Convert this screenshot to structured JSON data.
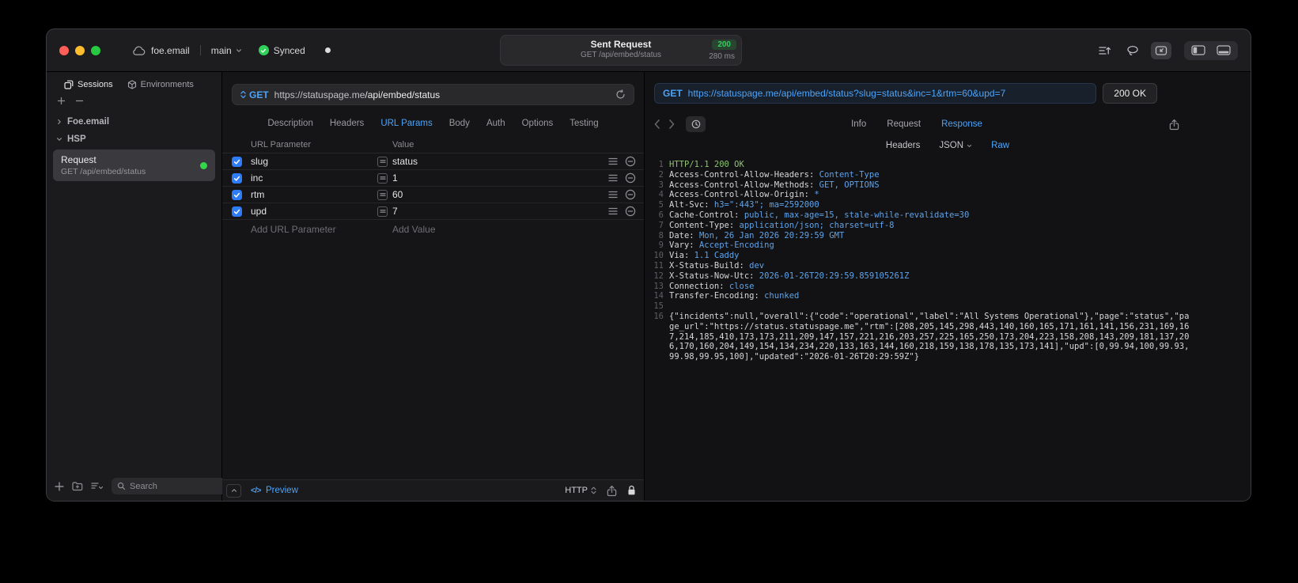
{
  "titlebar": {
    "project": "foe.email",
    "branch": "main",
    "sync_label": "Synced",
    "request_title": "Sent Request",
    "status_badge": "200",
    "request_subtitle": "GET /api/embed/status",
    "duration": "280 ms"
  },
  "sidebar": {
    "tabs": [
      {
        "label": "Sessions"
      },
      {
        "label": "Environments"
      }
    ],
    "tree": [
      {
        "label": "Foe.email"
      },
      {
        "label": "HSP"
      }
    ],
    "request_item": {
      "title": "Request",
      "subtitle": "GET /api/embed/status"
    },
    "search_placeholder": "Search"
  },
  "request": {
    "method": "GET",
    "url_domain": "https://statuspage.me",
    "url_path": "/api/embed/status",
    "tabs": [
      "Description",
      "Headers",
      "URL Params",
      "Body",
      "Auth",
      "Options",
      "Testing"
    ],
    "active_tab": "URL Params",
    "columns": {
      "name": "URL Parameter",
      "value": "Value"
    },
    "params": [
      {
        "name": "slug",
        "value": "status",
        "enabled": true
      },
      {
        "name": "inc",
        "value": "1",
        "enabled": true
      },
      {
        "name": "rtm",
        "value": "60",
        "enabled": true
      },
      {
        "name": "upd",
        "value": "7",
        "enabled": true
      }
    ],
    "add_name_placeholder": "Add URL Parameter",
    "add_value_placeholder": "Add Value",
    "footer": {
      "preview_icon": "</>",
      "preview_label": "Preview",
      "protocol": "HTTP"
    }
  },
  "response": {
    "method": "GET",
    "url": "https://statuspage.me/api/embed/status?slug=status&inc=1&rtm=60&upd=7",
    "status": "200 OK",
    "tabs": [
      "Info",
      "Request",
      "Response"
    ],
    "active_tab": "Response",
    "subtabs": [
      "Headers",
      "JSON",
      "Raw"
    ],
    "active_subtab": "Raw",
    "colors": {
      "accent_blue": "#4da3f8",
      "status_green": "#30d158"
    },
    "body_lines": [
      {
        "n": "1",
        "parts": [
          {
            "t": "HTTP/1.1 200 OK",
            "c": "green"
          }
        ]
      },
      {
        "n": "2",
        "parts": [
          {
            "t": "Access-Control-Allow-Headers: ",
            "c": "fg"
          },
          {
            "t": "Content-Type",
            "c": "blue"
          }
        ]
      },
      {
        "n": "3",
        "parts": [
          {
            "t": "Access-Control-Allow-Methods: ",
            "c": "fg"
          },
          {
            "t": "GET, OPTIONS",
            "c": "blue"
          }
        ]
      },
      {
        "n": "4",
        "parts": [
          {
            "t": "Access-Control-Allow-Origin: ",
            "c": "fg"
          },
          {
            "t": "*",
            "c": "blue"
          }
        ]
      },
      {
        "n": "5",
        "parts": [
          {
            "t": "Alt-Svc: ",
            "c": "fg"
          },
          {
            "t": "h3=\":443\"; ma=2592000",
            "c": "blue"
          }
        ]
      },
      {
        "n": "6",
        "parts": [
          {
            "t": "Cache-Control: ",
            "c": "fg"
          },
          {
            "t": "public, max-age=15, stale-while-revalidate=30",
            "c": "blue"
          }
        ]
      },
      {
        "n": "7",
        "parts": [
          {
            "t": "Content-Type: ",
            "c": "fg"
          },
          {
            "t": "application/json; charset=utf-8",
            "c": "blue"
          }
        ]
      },
      {
        "n": "8",
        "parts": [
          {
            "t": "Date: ",
            "c": "fg"
          },
          {
            "t": "Mon, 26 Jan 2026 20:29:59 GMT",
            "c": "blue"
          }
        ]
      },
      {
        "n": "9",
        "parts": [
          {
            "t": "Vary: ",
            "c": "fg"
          },
          {
            "t": "Accept-Encoding",
            "c": "blue"
          }
        ]
      },
      {
        "n": "10",
        "parts": [
          {
            "t": "Via: ",
            "c": "fg"
          },
          {
            "t": "1.1 Caddy",
            "c": "blue"
          }
        ]
      },
      {
        "n": "11",
        "parts": [
          {
            "t": "X-Status-Build: ",
            "c": "fg"
          },
          {
            "t": "dev",
            "c": "blue"
          }
        ]
      },
      {
        "n": "12",
        "parts": [
          {
            "t": "X-Status-Now-Utc: ",
            "c": "fg"
          },
          {
            "t": "2026-01-26T20:29:59.859105261Z",
            "c": "blue"
          }
        ]
      },
      {
        "n": "13",
        "parts": [
          {
            "t": "Connection: ",
            "c": "fg"
          },
          {
            "t": "close",
            "c": "blue"
          }
        ]
      },
      {
        "n": "14",
        "parts": [
          {
            "t": "Transfer-Encoding: ",
            "c": "fg"
          },
          {
            "t": "chunked",
            "c": "blue"
          }
        ]
      },
      {
        "n": "15",
        "parts": []
      },
      {
        "n": "16",
        "parts": [
          {
            "t": "{\"incidents\":null,\"overall\":{\"code\":\"operational\",\"label\":\"All Systems Operational\"},\"page\":\"status\",\"page_url\":\"https://status.statuspage.me\",\"rtm\":[208,205,145,298,443,140,160,165,171,161,141,156,231,169,167,214,185,410,173,173,211,209,147,157,221,216,203,257,225,165,250,173,204,223,158,208,143,209,181,137,206,170,160,204,149,154,134,234,220,133,163,144,160,218,159,138,178,135,173,141],\"upd\":[0,99.94,100,99.93,99.98,99.95,100],\"updated\":\"2026-01-26T20:29:59Z\"}",
            "c": "fg"
          }
        ]
      }
    ]
  }
}
